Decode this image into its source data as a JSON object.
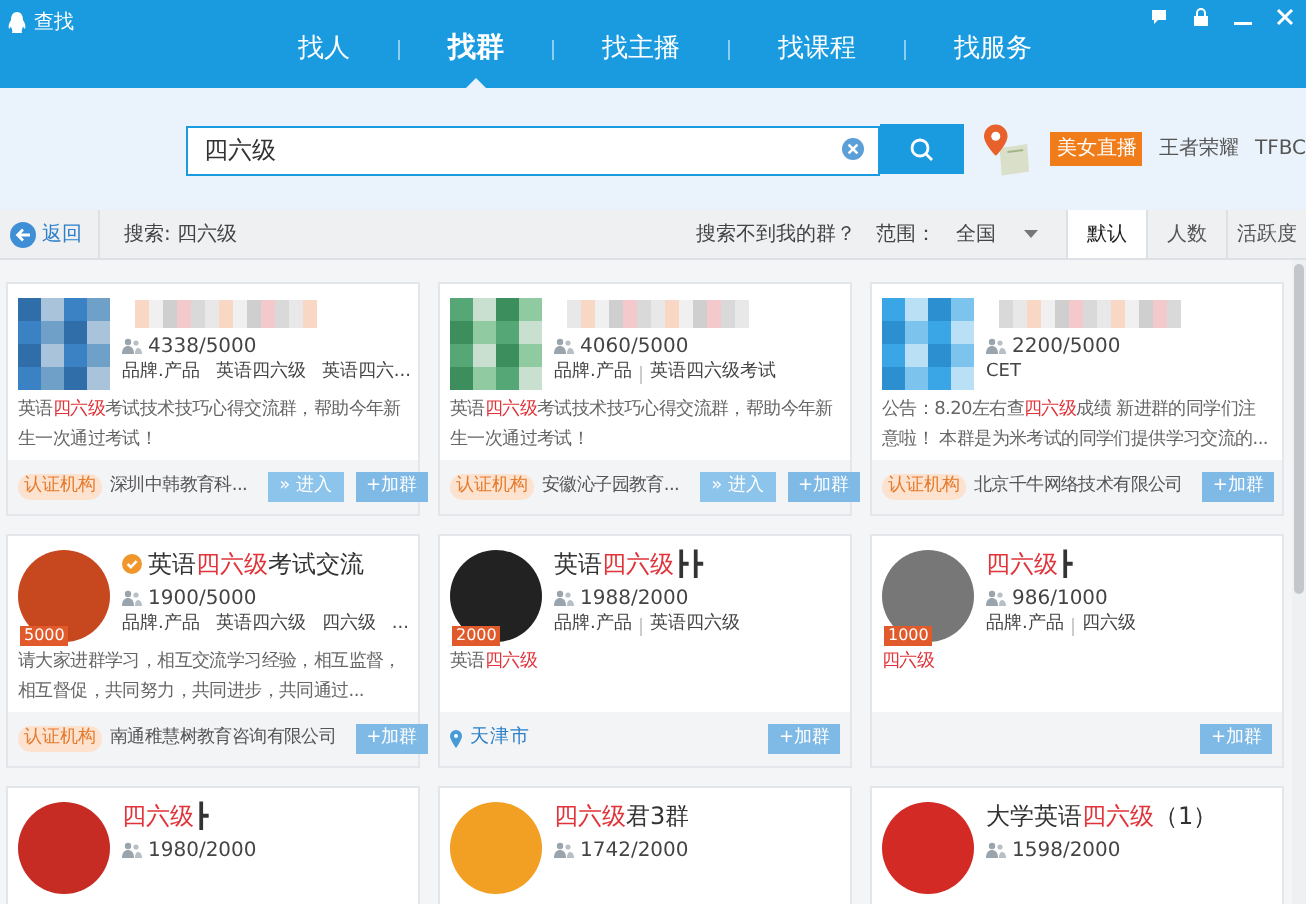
{
  "window": {
    "title": "查找"
  },
  "nav_tabs": [
    {
      "label": "找人",
      "selected": false
    },
    {
      "label": "找群",
      "selected": true
    },
    {
      "label": "找主播",
      "selected": false
    },
    {
      "label": "找课程",
      "selected": false
    },
    {
      "label": "找服务",
      "selected": false
    }
  ],
  "search": {
    "value": "四六级"
  },
  "hot_tags": [
    {
      "label": "美女直播",
      "kind": "badge"
    },
    {
      "label": "王者荣耀",
      "kind": "text"
    },
    {
      "label": "TFBC",
      "kind": "text"
    }
  ],
  "filter_bar": {
    "back": "返回",
    "search_label": "搜索: 四六级",
    "help_link": "搜索不到我的群？",
    "range_label": "范围：",
    "range_value": "全国",
    "sort_tabs": [
      {
        "label": "默认",
        "selected": true
      },
      {
        "label": "人数",
        "selected": false
      },
      {
        "label": "活跃度",
        "selected": false
      }
    ]
  },
  "groups": [
    {
      "avatar": {
        "kind": "blurred"
      },
      "members": "4338/5000",
      "tags": [
        "品牌.产品",
        "英语四六级",
        "英语四六..."
      ],
      "description_parts": [
        {
          "text": "英语",
          "highlight": false
        },
        {
          "text": "四六级",
          "highlight": true
        },
        {
          "text": "考试技术技巧心得交流群，帮助今年新生一次通过考试！",
          "highlight": false
        }
      ],
      "certified_label": "认证机构",
      "organization": "深圳中韩教育科...",
      "buttons": [
        {
          "label": "» 进入",
          "kind": "enter"
        },
        {
          "label": "+加群",
          "kind": "join"
        }
      ]
    },
    {
      "avatar": {
        "kind": "blurred"
      },
      "members": "4060/5000",
      "tags": [
        "品牌.产品",
        "英语四六级考试"
      ],
      "description_parts": [
        {
          "text": "英语",
          "highlight": false
        },
        {
          "text": "四六级",
          "highlight": true
        },
        {
          "text": "考试技术技巧心得交流群，帮助今年新生一次通过考试！",
          "highlight": false
        }
      ],
      "certified_label": "认证机构",
      "organization": "安徽沁子园教育...",
      "buttons": [
        {
          "label": "» 进入",
          "kind": "enter"
        },
        {
          "label": "+加群",
          "kind": "join"
        }
      ]
    },
    {
      "avatar": {
        "kind": "blurred"
      },
      "members": "2200/5000",
      "tags": [
        "CET"
      ],
      "description_parts": [
        {
          "text": "公告：8.20左右查",
          "highlight": false
        },
        {
          "text": "四六级",
          "highlight": true
        },
        {
          "text": "成绩 新进群的同学们注意啦！ 本群是为米考试的同学们提供学习交流的...",
          "highlight": false
        }
      ],
      "certified_label": "认证机构",
      "organization": "北京千牛网络技术有限公司",
      "buttons": [
        {
          "label": "+加群",
          "kind": "join"
        }
      ]
    },
    {
      "avatar": {
        "kind": "image",
        "badge": "5000"
      },
      "title_parts": [
        {
          "text": "英语",
          "highlight": false
        },
        {
          "text": "四六级",
          "highlight": true
        },
        {
          "text": "考试交流",
          "highlight": false
        }
      ],
      "verified": true,
      "members": "1900/5000",
      "tags": [
        "品牌.产品",
        "英语四六级",
        "四六级",
        "..."
      ],
      "description_parts": [
        {
          "text": "请大家进群学习，相互交流学习经验，相互监督，相互督促，共同努力，共同进步，共同通过...",
          "highlight": false
        }
      ],
      "certified_label": "认证机构",
      "organization": "南通稚慧树教育咨询有限公司",
      "buttons": [
        {
          "label": "+加群",
          "kind": "join"
        }
      ]
    },
    {
      "avatar": {
        "kind": "image",
        "badge": "2000"
      },
      "title_parts": [
        {
          "text": "英语",
          "highlight": false
        },
        {
          "text": "四六级",
          "highlight": true
        },
        {
          "text": "┣┣",
          "highlight": false
        }
      ],
      "members": "1988/2000",
      "tags": [
        "品牌.产品",
        "英语四六级"
      ],
      "description_parts": [
        {
          "text": "英语",
          "highlight": false
        },
        {
          "text": "四六级",
          "highlight": true
        }
      ],
      "location": "天津市",
      "buttons": [
        {
          "label": "+加群",
          "kind": "join"
        }
      ]
    },
    {
      "avatar": {
        "kind": "image",
        "badge": "1000"
      },
      "title_parts": [
        {
          "text": "四六级",
          "highlight": true
        },
        {
          "text": "┣",
          "highlight": false
        }
      ],
      "members": "986/1000",
      "tags": [
        "品牌.产品",
        "四六级"
      ],
      "description_parts": [
        {
          "text": "四六级",
          "highlight": true
        }
      ],
      "buttons": [
        {
          "label": "+加群",
          "kind": "join"
        }
      ]
    },
    {
      "avatar": {
        "kind": "image"
      },
      "title_parts": [
        {
          "text": "四六级",
          "highlight": true
        },
        {
          "text": "┣",
          "highlight": false
        }
      ],
      "members": "1980/2000"
    },
    {
      "avatar": {
        "kind": "image"
      },
      "title_parts": [
        {
          "text": "四六级",
          "highlight": true
        },
        {
          "text": "君3群",
          "highlight": false
        }
      ],
      "members": "1742/2000"
    },
    {
      "avatar": {
        "kind": "image"
      },
      "title_parts": [
        {
          "text": "大学英语",
          "highlight": false
        },
        {
          "text": "四六级",
          "highlight": true
        },
        {
          "text": "（1）",
          "highlight": false
        }
      ],
      "members": "1598/2000"
    }
  ]
}
